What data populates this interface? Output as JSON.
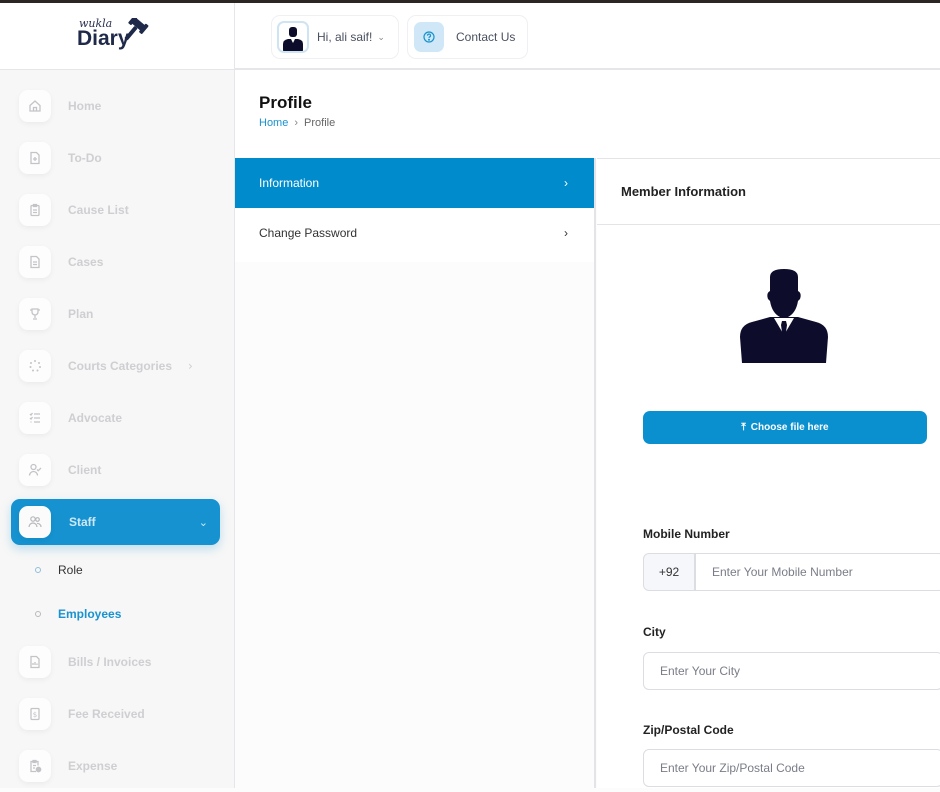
{
  "app": {
    "logo_script": "wukla",
    "logo_word": "Diary"
  },
  "header": {
    "greeting": "Hi, ali saif!",
    "contact_label": "Contact Us"
  },
  "sidebar": {
    "items": [
      {
        "label": "Home",
        "icon": "home-icon"
      },
      {
        "label": "To-Do",
        "icon": "file-plus-icon"
      },
      {
        "label": "Cause List",
        "icon": "clipboard-icon"
      },
      {
        "label": "Cases",
        "icon": "document-icon"
      },
      {
        "label": "Plan",
        "icon": "trophy-icon"
      },
      {
        "label": "Courts Categories",
        "icon": "loader-icon",
        "has_submenu": true
      },
      {
        "label": "Advocate",
        "icon": "checklist-icon"
      },
      {
        "label": "Client",
        "icon": "user-check-icon"
      },
      {
        "label": "Staff",
        "icon": "users-icon",
        "active": true,
        "expanded": true
      },
      {
        "label": "Bills / Invoices",
        "icon": "invoice-icon"
      },
      {
        "label": "Fee Received",
        "icon": "receipt-dollar-icon"
      },
      {
        "label": "Expense",
        "icon": "clipboard-clock-icon"
      }
    ],
    "staff_subitems": [
      {
        "label": "Role",
        "current": false
      },
      {
        "label": "Employees",
        "current": true
      }
    ]
  },
  "page": {
    "title": "Profile",
    "breadcrumb": [
      "Home",
      "Profile"
    ]
  },
  "tabs": [
    {
      "label": "Information",
      "active": true
    },
    {
      "label": "Change Password",
      "active": false
    }
  ],
  "card": {
    "title": "Member Information",
    "upload_label": "Choose file here",
    "fields": {
      "mobile": {
        "label": "Mobile Number",
        "prefix": "+92",
        "placeholder": "Enter Your Mobile Number",
        "value": ""
      },
      "city": {
        "label": "City",
        "placeholder": "Enter Your City",
        "value": ""
      },
      "zip": {
        "label": "Zip/Postal Code",
        "placeholder": "Enter Your Zip/Postal Code",
        "value": ""
      }
    }
  },
  "colors": {
    "accent": "#008ccc",
    "sidebar_active": "#1592cf",
    "avatar_dark": "#0d0d2b"
  }
}
